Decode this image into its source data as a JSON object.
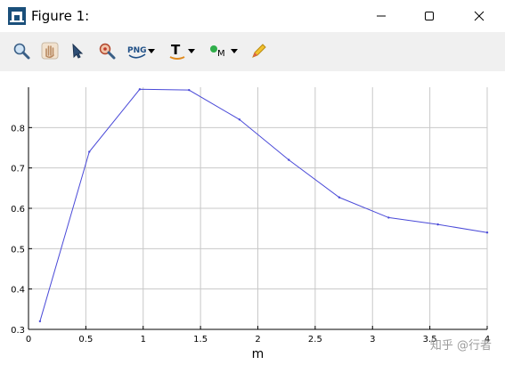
{
  "window": {
    "title": "Figure 1:",
    "controls": {
      "minimize": "minimize",
      "maximize": "maximize",
      "close": "close"
    }
  },
  "toolbar": {
    "buttons": [
      {
        "name": "zoom-icon"
      },
      {
        "name": "pan-hand-icon"
      },
      {
        "name": "select-pointer-icon"
      },
      {
        "name": "data-cursor-icon"
      },
      {
        "name": "png-export-icon",
        "label": "PNG",
        "dropdown": true
      },
      {
        "name": "text-icon",
        "label": "T",
        "dropdown": true
      },
      {
        "name": "marker-icon",
        "label": "M",
        "dropdown": true
      },
      {
        "name": "pencil-icon"
      }
    ]
  },
  "chart_data": {
    "type": "line",
    "xlabel": "m",
    "ylabel": "",
    "xlim": [
      0,
      4
    ],
    "ylim": [
      0.3,
      0.9
    ],
    "xticks": [
      "0",
      "0.5",
      "1",
      "1.5",
      "2",
      "2.5",
      "3",
      "3.5",
      "4"
    ],
    "yticks": [
      "0.3",
      "0.4",
      "0.5",
      "0.6",
      "0.7",
      "0.8"
    ],
    "grid": true,
    "series": [
      {
        "color": "#4a4ad8",
        "x": [
          0.1,
          0.53,
          0.97,
          1.4,
          1.84,
          2.27,
          2.71,
          3.14,
          3.57,
          4.0
        ],
        "y": [
          0.32,
          0.74,
          0.895,
          0.893,
          0.82,
          0.72,
          0.627,
          0.577,
          0.56,
          0.54
        ]
      }
    ]
  },
  "watermark": "知乎 @行者",
  "colors": {
    "toolbar_bg": "#f0f0f0",
    "grid": "#c8c8c8",
    "line": "#4a4ad8"
  }
}
